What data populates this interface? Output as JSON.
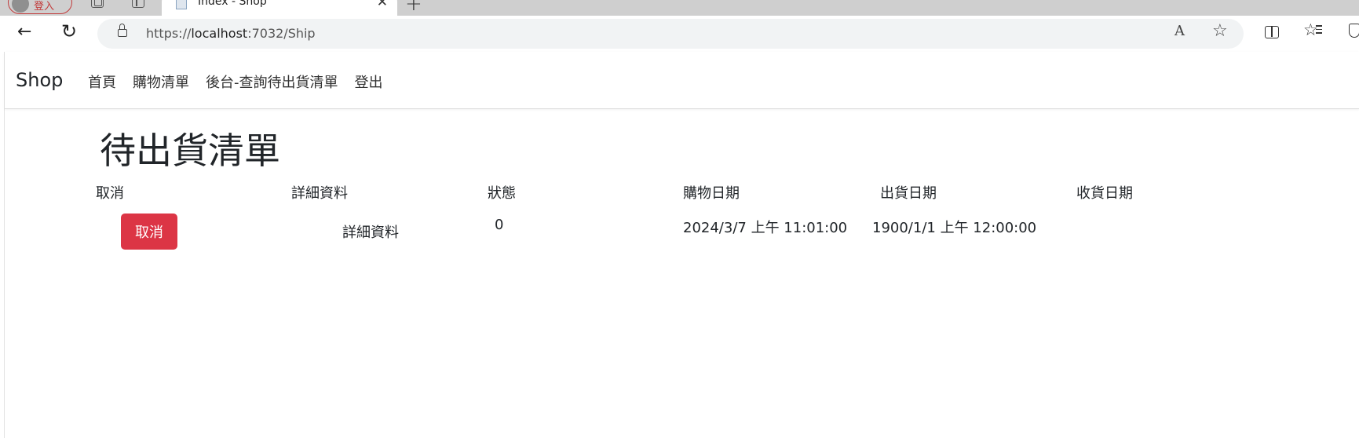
{
  "browser": {
    "profile_label": "登入",
    "tab_title": "Index - Shop",
    "tab_close": "✕",
    "new_tab": "+",
    "url_scheme": "https://",
    "url_host": "localhost",
    "url_path": ":7032/Ship",
    "read_aloud": "A",
    "star": "☆",
    "favorites": "☆"
  },
  "navbar": {
    "brand": "Shop",
    "links": [
      "首頁",
      "購物清單",
      "後台-查詢待出貨清單",
      "登出"
    ]
  },
  "page_title": "待出貨清單",
  "table": {
    "headers": [
      "取消",
      "詳細資料",
      "狀態",
      "購物日期",
      "出貨日期",
      "收貨日期"
    ],
    "rows": [
      {
        "cancel_label": "取消",
        "details_label": "詳細資料",
        "status": "0",
        "order_date": "2024/3/7 上午 11:01:00",
        "ship_date": "1900/1/1 上午 12:00:00",
        "receive_date": ""
      }
    ]
  },
  "colors": {
    "danger": "#dc3545",
    "tabstrip": "#cfcfcf",
    "urlbar": "#f1f3f4"
  }
}
